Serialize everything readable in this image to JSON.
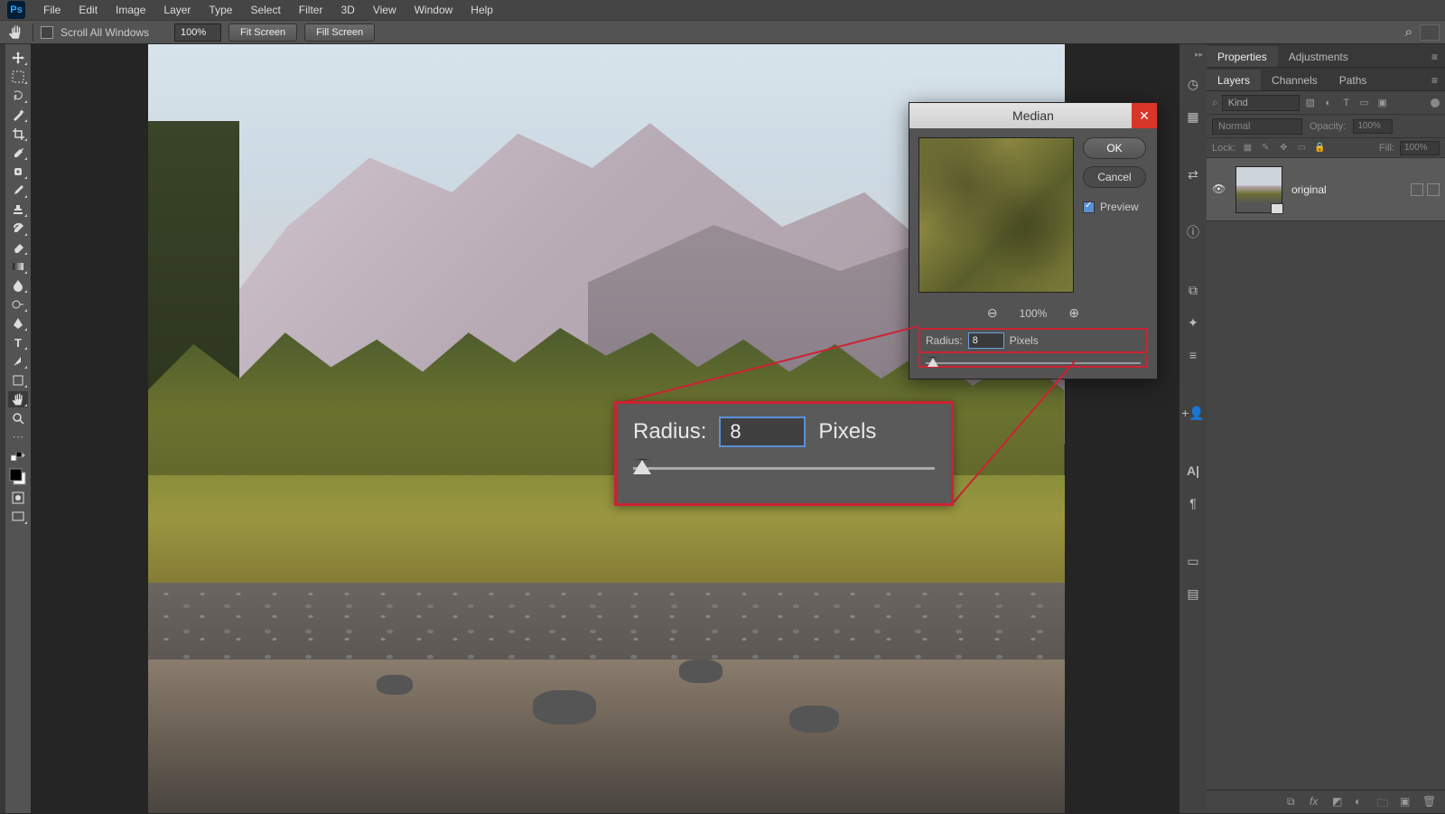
{
  "menu": {
    "items": [
      "File",
      "Edit",
      "Image",
      "Layer",
      "Type",
      "Select",
      "Filter",
      "3D",
      "View",
      "Window",
      "Help"
    ]
  },
  "optionsBar": {
    "scrollAll": "Scroll All Windows",
    "zoom": "100%",
    "fitScreen": "Fit Screen",
    "fillScreen": "Fill Screen"
  },
  "dialog": {
    "title": "Median",
    "ok": "OK",
    "cancel": "Cancel",
    "preview": "Preview",
    "previewZoom": "100%",
    "radiusLabel": "Radius:",
    "radiusValue": "8",
    "radiusUnit": "Pixels"
  },
  "callout": {
    "radiusLabel": "Radius:",
    "radiusValue": "8",
    "radiusUnit": "Pixels"
  },
  "panels": {
    "propTabs": [
      "Properties",
      "Adjustments"
    ],
    "layerTabs": [
      "Layers",
      "Channels",
      "Paths"
    ],
    "filterKind": "Kind",
    "blendMode": "Normal",
    "opacityLabel": "Opacity:",
    "opacityValue": "100%",
    "lockLabel": "Lock:",
    "fillLabel": "Fill:",
    "fillValue": "100%",
    "layerName": "original"
  },
  "icons": {
    "search": "⌕",
    "frame": "▢",
    "hand": "✋"
  }
}
